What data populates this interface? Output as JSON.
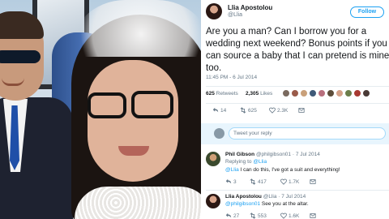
{
  "tweet": {
    "author_name": "Llia Apostolou",
    "author_handle": "@Llia",
    "follow_label": "Follow",
    "text": "Are you a man? Can I borrow you for a wedding next weekend? Bonus points if you can source a baby that I can pretend is mine too.",
    "timestamp": "11:45 PM - 6 Jul 2014",
    "retweets_count": "625",
    "retweets_label": "Retweets",
    "likes_count": "2,305",
    "likes_label": "Likes",
    "actions": {
      "replies": "14",
      "retweets": "625",
      "likes": "2.3K"
    }
  },
  "reply_box": {
    "placeholder": "Tweet your reply"
  },
  "replies": [
    {
      "name": "Phil Gibson",
      "handle": "@philgibson01",
      "date": "7 Jul 2014",
      "replying_prefix": "Replying to",
      "replying_to": "@Llia",
      "mention": "@Llia",
      "text": "I can do this, I've got a suit and everything!",
      "actions": {
        "replies": "3",
        "retweets": "417",
        "likes": "1.7K"
      }
    },
    {
      "name": "Llia Apostolou",
      "handle": "@Llia",
      "date": "7 Jul 2014",
      "mention": "@philgibson01",
      "text": "See you at the altar.",
      "actions": {
        "replies": "27",
        "retweets": "553",
        "likes": "1.6K"
      }
    }
  ],
  "colors": {
    "accent": "#1da1f2",
    "secondary_text": "#657786",
    "reply_bg": "#e8f5fd"
  },
  "icons": [
    "reply-icon",
    "retweet-icon",
    "heart-icon",
    "message-icon"
  ]
}
